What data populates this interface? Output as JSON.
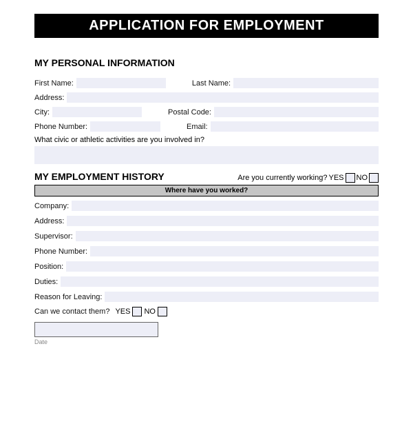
{
  "header": {
    "title": "APPLICATION FOR EMPLOYMENT"
  },
  "personal": {
    "section_title": "MY PERSONAL INFORMATION",
    "first_name_label": "First Name:",
    "last_name_label": "Last Name:",
    "address_label": "Address:",
    "city_label": "City:",
    "postal_code_label": "Postal Code:",
    "phone_label": "Phone Number:",
    "email_label": "Email:",
    "activities_label": "What civic or athletic activities are you involved in?"
  },
  "employment": {
    "section_title": "MY EMPLOYMENT HISTORY",
    "currently_working_label": "Are you currently working?",
    "yes": "YES",
    "no": "NO",
    "where_worked": "Where have you worked?",
    "company_label": "Company:",
    "address_label": "Address:",
    "supervisor_label": "Supervisor:",
    "phone_label": "Phone Number:",
    "position_label": "Position:",
    "duties_label": "Duties:",
    "reason_label": "Reason for Leaving:",
    "contact_label": "Can we contact them?"
  },
  "footer": {
    "date_label": "Date"
  }
}
